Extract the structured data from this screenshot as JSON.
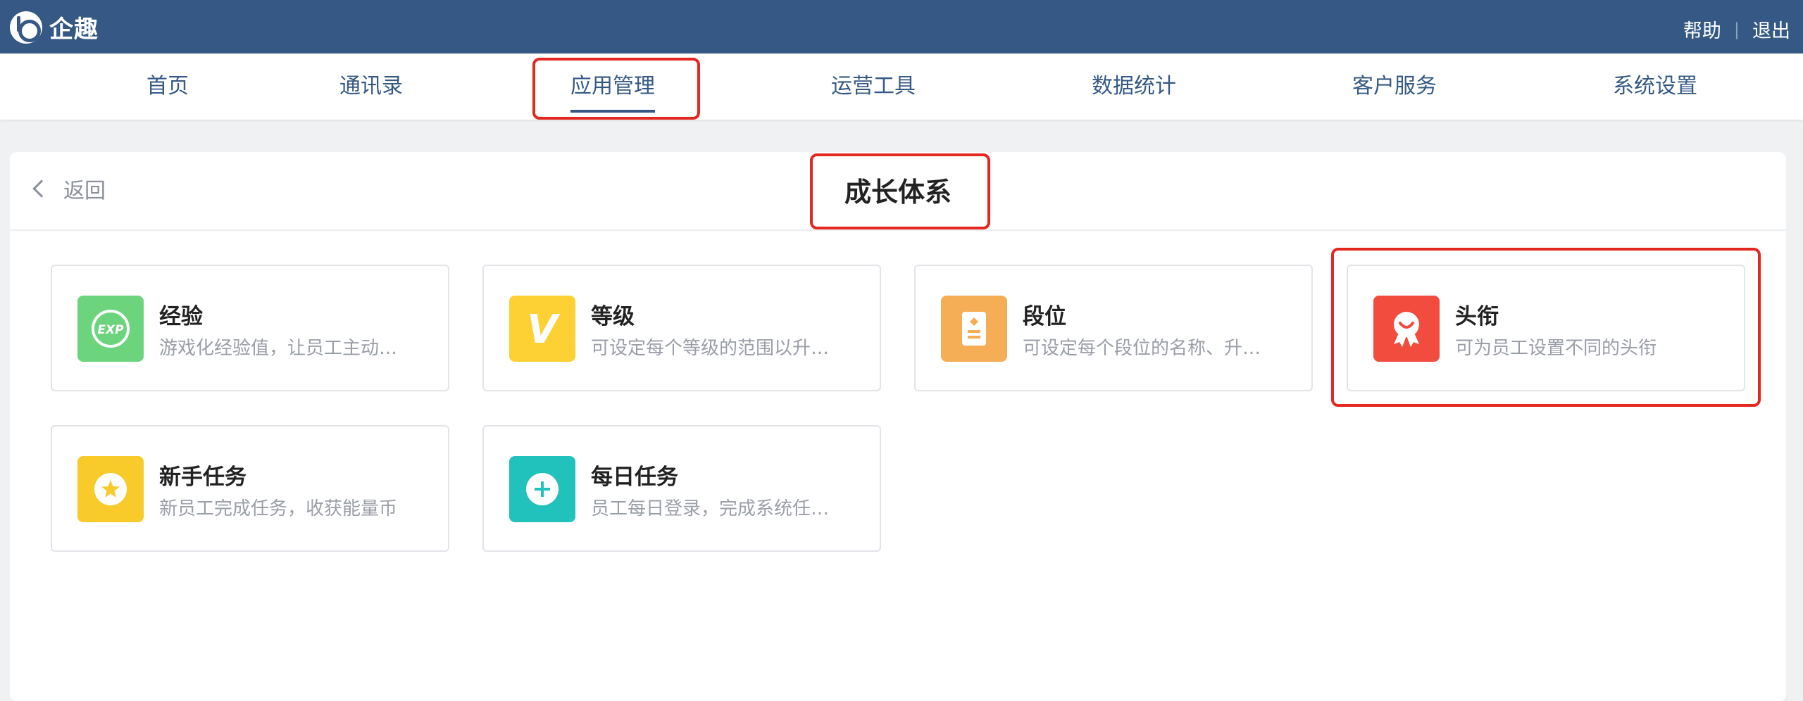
{
  "app": {
    "name": "企趣"
  },
  "top_links": {
    "help": "帮助",
    "separator": "|",
    "logout": "退出"
  },
  "nav": {
    "items": [
      {
        "label": "首页"
      },
      {
        "label": "通讯录"
      },
      {
        "label": "应用管理",
        "active": true
      },
      {
        "label": "运营工具"
      },
      {
        "label": "数据统计"
      },
      {
        "label": "客户服务"
      },
      {
        "label": "系统设置"
      }
    ]
  },
  "page": {
    "back_label": "返回",
    "title": "成长体系"
  },
  "cards": [
    {
      "title": "经验",
      "desc": "游戏化经验值，让员工主动…",
      "icon": "exp-icon",
      "color": "#6dd47e",
      "icon_text": "EXP"
    },
    {
      "title": "等级",
      "desc": "可设定每个等级的范围以升…",
      "icon": "level-v-icon",
      "color": "#fdd033",
      "icon_text": "V"
    },
    {
      "title": "段位",
      "desc": "可设定每个段位的名称、升…",
      "icon": "rank-badge-icon",
      "color": "#f5ae55"
    },
    {
      "title": "头衔",
      "desc": "可为员工设置不同的头衔",
      "icon": "medal-icon",
      "color": "#f24c3f"
    },
    {
      "title": "新手任务",
      "desc": "新员工完成任务，收获能量币",
      "icon": "star-icon",
      "color": "#f8ca2a"
    },
    {
      "title": "每日任务",
      "desc": "员工每日登录，完成系统任…",
      "icon": "plus-circle-icon",
      "color": "#21c2bc"
    }
  ],
  "colors": {
    "header_bg": "#355984",
    "highlight": "#e4281f"
  }
}
